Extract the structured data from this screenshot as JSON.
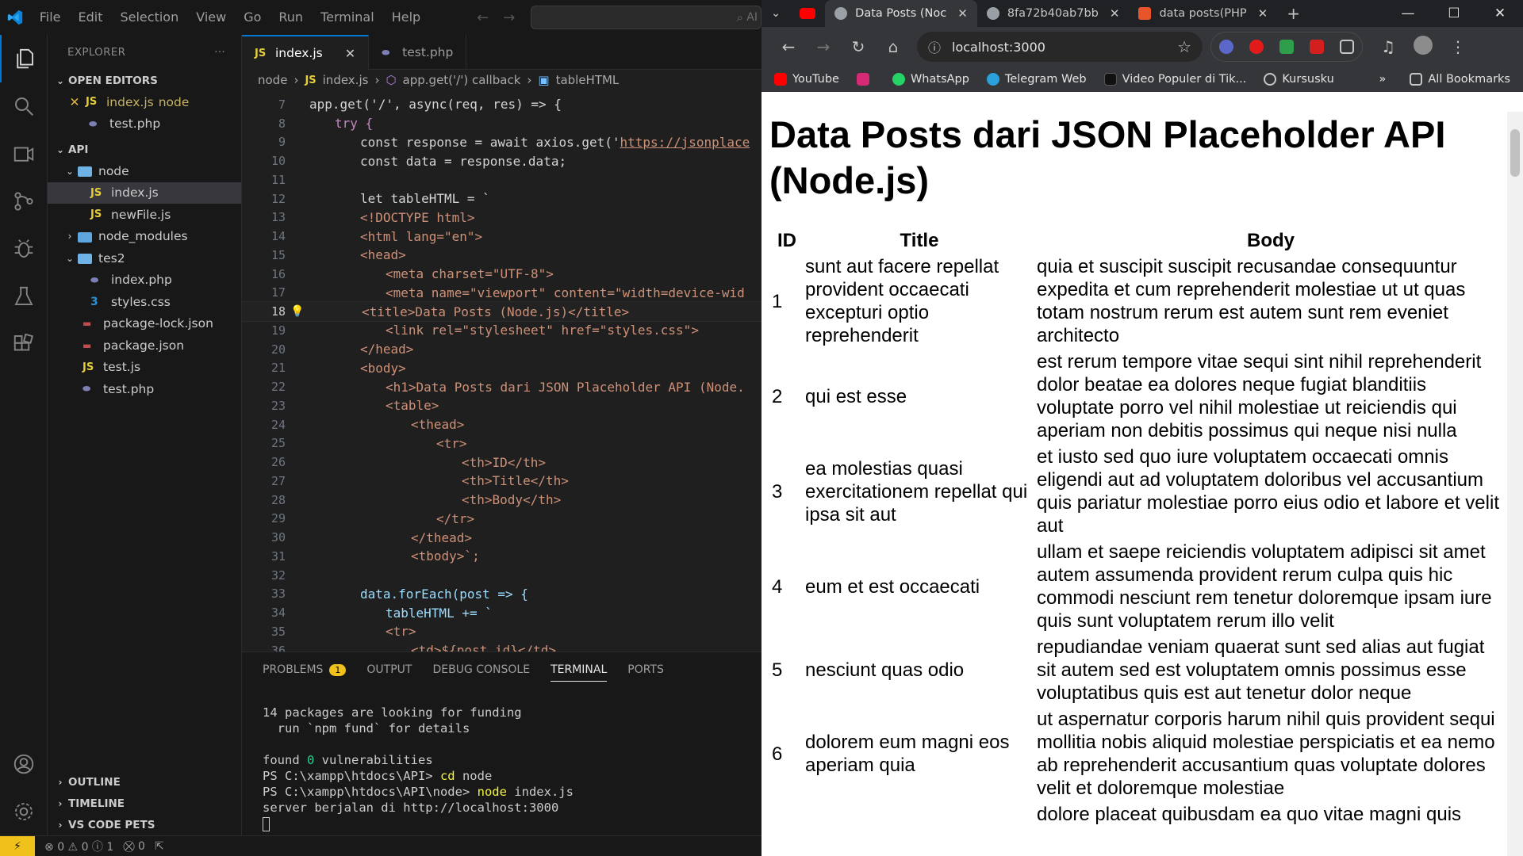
{
  "vscode": {
    "menu": [
      "File",
      "Edit",
      "Selection",
      "View",
      "Go",
      "Run",
      "Terminal",
      "Help"
    ],
    "search_ai": "AI",
    "explorer_title": "EXPLORER",
    "open_editors_title": "OPEN EDITORS",
    "open_editors": [
      {
        "name": "index.js",
        "hint": "node",
        "icon": "JS"
      },
      {
        "name": "test.php",
        "hint": "",
        "icon": "php"
      }
    ],
    "workspace_title": "API",
    "tree": {
      "node_folder": "node",
      "node_index": "index.js",
      "node_newfile": "newFile.js",
      "node_modules": "node_modules",
      "tes2_folder": "tes2",
      "tes2_index": "index.php",
      "tes2_styles": "styles.css",
      "package_lock": "package-lock.json",
      "package_json": "package.json",
      "test_js": "test.js",
      "test_php": "test.php"
    },
    "bottom_sections": [
      "OUTLINE",
      "TIMELINE",
      "VS CODE PETS"
    ],
    "tabs": [
      {
        "label": "index.js",
        "icon": "JS"
      },
      {
        "label": "test.php",
        "icon": "php"
      }
    ],
    "breadcrumb": [
      "node",
      "index.js",
      "app.get('/') callback",
      "tableHTML"
    ],
    "line_numbers": [
      "7",
      "8",
      "9",
      "10",
      "11",
      "12",
      "13",
      "14",
      "15",
      "16",
      "17",
      "18",
      "19",
      "20",
      "21",
      "22",
      "23",
      "24",
      "25",
      "26",
      "27",
      "28",
      "29",
      "30",
      "31",
      "32",
      "33",
      "34",
      "35",
      "36"
    ],
    "code": {
      "l7": "app.get('/', async(req, res) => {",
      "l8": "try {",
      "l9a": "const response = await axios.get('",
      "l9b": "https://jsonplace",
      "l10": "const data = response.data;",
      "l12": "let tableHTML = `",
      "l13": "<!DOCTYPE html>",
      "l14": "<html lang=\"en\">",
      "l15": "<head>",
      "l16": "<meta charset=\"UTF-8\">",
      "l17": "<meta name=\"viewport\" content=\"width=device-wid",
      "l18": "<title>Data Posts (Node.js)</title>",
      "l19": "<link rel=\"stylesheet\" href=\"styles.css\">",
      "l20": "</head>",
      "l21": "<body>",
      "l22": "<h1>Data Posts dari JSON Placeholder API (Node.",
      "l23": "<table>",
      "l24": "<thead>",
      "l25": "<tr>",
      "l26": "<th>ID</th>",
      "l27": "<th>Title</th>",
      "l28": "<th>Body</th>",
      "l29": "</tr>",
      "l30": "</thead>",
      "l31": "<tbody>`;",
      "l33": "data.forEach(post => {",
      "l34": "tableHTML += `",
      "l35": "<tr>",
      "l36": "<td>${post.id}</td>"
    },
    "panel_tabs": [
      "PROBLEMS",
      "OUTPUT",
      "DEBUG CONSOLE",
      "TERMINAL",
      "PORTS"
    ],
    "problems_count": "1",
    "terminal": {
      "l1": "14 packages are looking for funding",
      "l2": "  run `npm fund` for details",
      "l3a": "found ",
      "l3b": "0",
      "l3c": " vulnerabilities",
      "l4a": "PS C:\\xampp\\htdocs\\API> ",
      "l4b": "cd",
      "l4c": " node",
      "l5a": "PS C:\\xampp\\htdocs\\API\\node> ",
      "l5b": "node",
      "l5c": " index.js",
      "l6": "server berjalan di http://localhost:3000"
    },
    "status": {
      "errors": "0",
      "warnings": "0",
      "info": "1",
      "ports": "0"
    }
  },
  "chrome": {
    "tabs": [
      {
        "label": "Data Posts (Noc",
        "favicon_color": "#9aa0a6",
        "active": true
      },
      {
        "label": "8fa72b40ab7bb",
        "favicon_color": "#9aa0a6",
        "active": false
      },
      {
        "label": "data posts(PHP",
        "favicon_color": "#e8542a",
        "active": false
      }
    ],
    "url": "localhost:3000",
    "bookmarks": [
      "YouTube",
      "WhatsApp",
      "Telegram Web",
      "Video Populer di Tik...",
      "Kursusku"
    ],
    "all_bookmarks": "All Bookmarks"
  },
  "page": {
    "title": "Data Posts dari JSON Placeholder API (Node.js)",
    "headers": [
      "ID",
      "Title",
      "Body"
    ],
    "rows": [
      {
        "id": "1",
        "title": "sunt aut facere repellat provident occaecati excepturi optio reprehenderit",
        "body": "quia et suscipit suscipit recusandae consequuntur expedita et cum reprehenderit molestiae ut ut quas totam nostrum rerum est autem sunt rem eveniet architecto"
      },
      {
        "id": "2",
        "title": "qui est esse",
        "body": "est rerum tempore vitae sequi sint nihil reprehenderit dolor beatae ea dolores neque fugiat blanditiis voluptate porro vel nihil molestiae ut reiciendis qui aperiam non debitis possimus qui neque nisi nulla"
      },
      {
        "id": "3",
        "title": "ea molestias quasi exercitationem repellat qui ipsa sit aut",
        "body": "et iusto sed quo iure voluptatem occaecati omnis eligendi aut ad voluptatem doloribus vel accusantium quis pariatur molestiae porro eius odio et labore et velit aut"
      },
      {
        "id": "4",
        "title": "eum et est occaecati",
        "body": "ullam et saepe reiciendis voluptatem adipisci sit amet autem assumenda provident rerum culpa quis hic commodi nesciunt rem tenetur doloremque ipsam iure quis sunt voluptatem rerum illo velit"
      },
      {
        "id": "5",
        "title": "nesciunt quas odio",
        "body": "repudiandae veniam quaerat sunt sed alias aut fugiat sit autem sed est voluptatem omnis possimus esse voluptatibus quis est aut tenetur dolor neque"
      },
      {
        "id": "6",
        "title": "dolorem eum magni eos aperiam quia",
        "body": "ut aspernatur corporis harum nihil quis provident sequi mollitia nobis aliquid molestiae perspiciatis et ea nemo ab reprehenderit accusantium quas voluptate dolores velit et doloremque molestiae"
      },
      {
        "id": "",
        "title": "",
        "body": "dolore placeat quibusdam ea quo vitae magni quis"
      }
    ]
  }
}
